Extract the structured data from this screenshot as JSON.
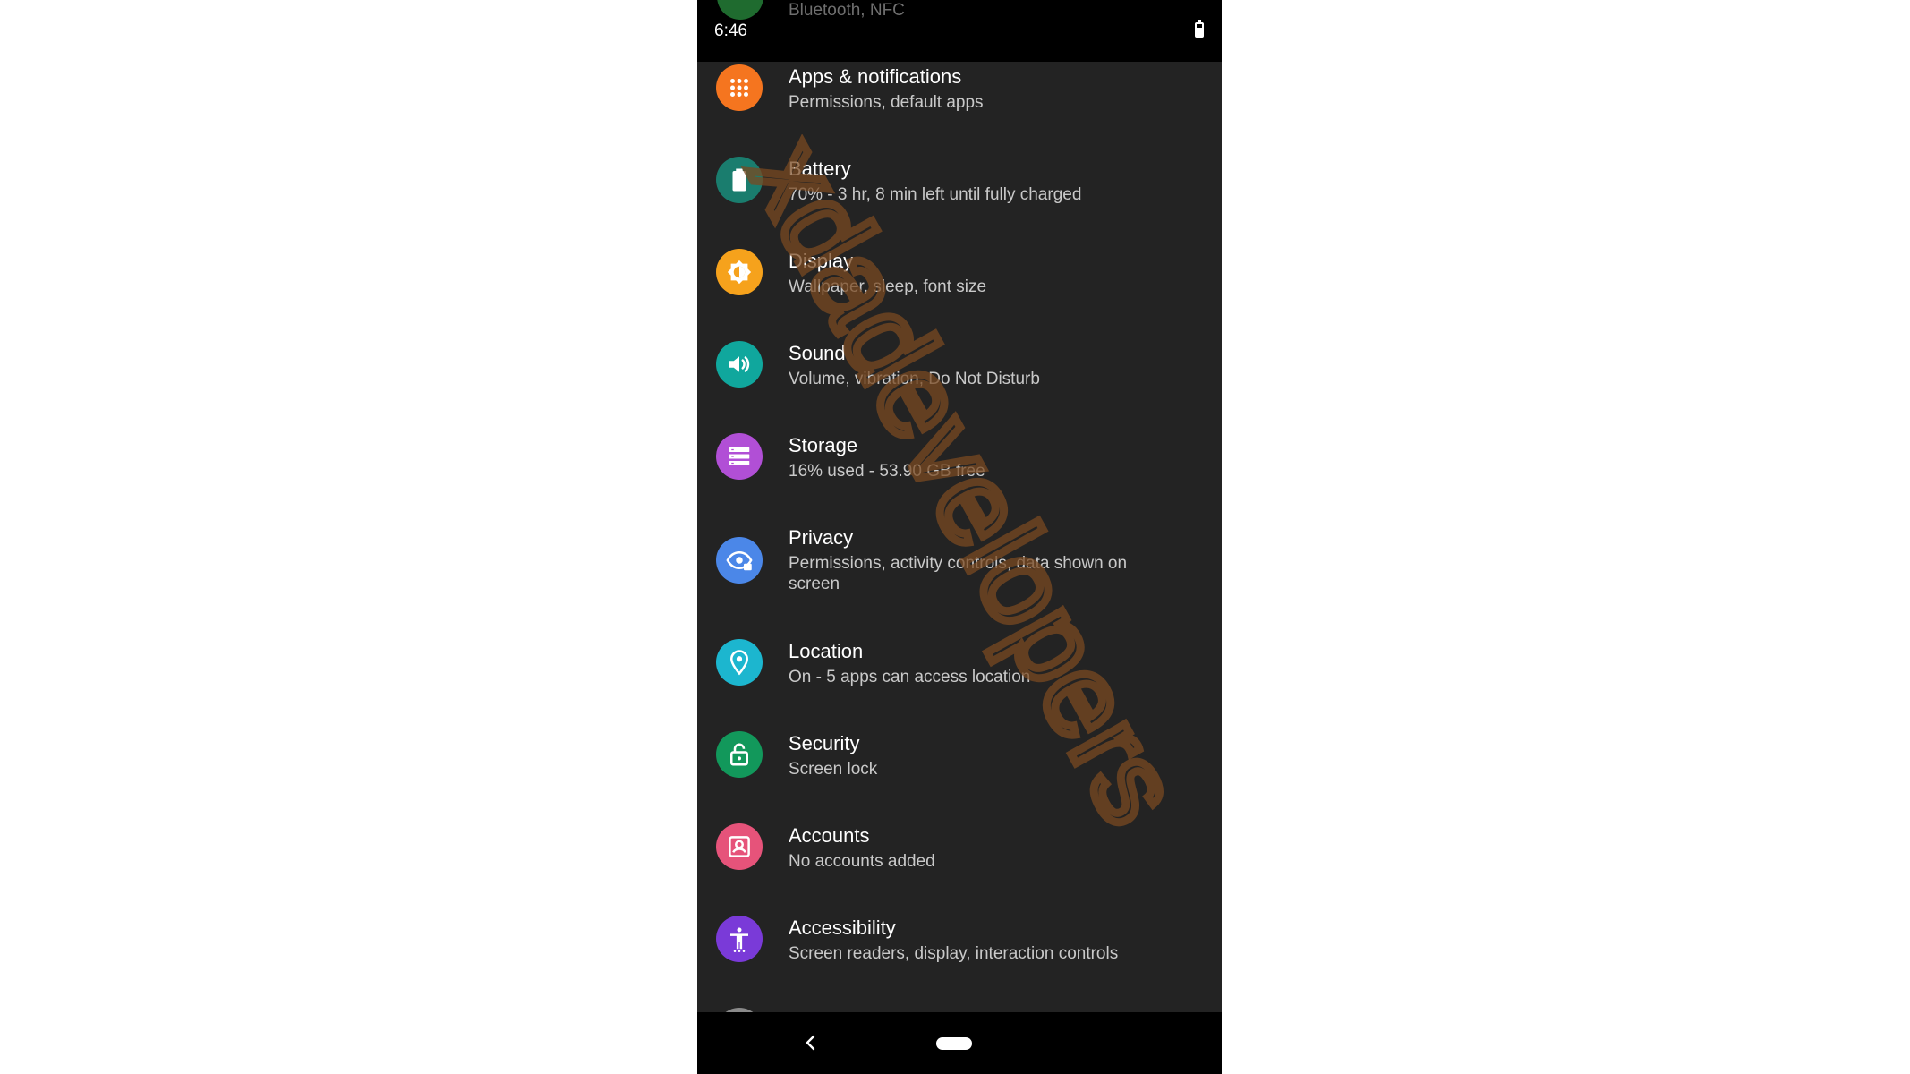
{
  "status_bar": {
    "time": "6:46"
  },
  "peek_item": {
    "subtitle": "Bluetooth, NFC"
  },
  "settings": [
    {
      "title": "Apps & notifications",
      "subtitle": "Permissions, default apps",
      "icon": "apps-grid-icon",
      "color": "#f5751f"
    },
    {
      "title": "Battery",
      "subtitle": "70% - 3 hr, 8 min left until fully charged",
      "icon": "battery-icon",
      "color": "#1a7d6e"
    },
    {
      "title": "Display",
      "subtitle": "Wallpaper, sleep, font size",
      "icon": "brightness-icon",
      "color": "#f6a21c"
    },
    {
      "title": "Sound",
      "subtitle": "Volume, vibration, Do Not Disturb",
      "icon": "volume-icon",
      "color": "#10a79d"
    },
    {
      "title": "Storage",
      "subtitle": "16% used - 53.90 GB free",
      "icon": "storage-icon",
      "color": "#b14fd6"
    },
    {
      "title": "Privacy",
      "subtitle": "Permissions, activity controls, data shown on screen",
      "icon": "privacy-eye-icon",
      "color": "#4b87e8"
    },
    {
      "title": "Location",
      "subtitle": "On - 5 apps can access location",
      "icon": "location-pin-icon",
      "color": "#1cb6cf"
    },
    {
      "title": "Security",
      "subtitle": "Screen lock",
      "icon": "lock-icon",
      "color": "#12985b"
    },
    {
      "title": "Accounts",
      "subtitle": "No accounts added",
      "icon": "account-icon",
      "color": "#e6537a"
    },
    {
      "title": "Accessibility",
      "subtitle": "Screen readers, display, interaction controls",
      "icon": "accessibility-icon",
      "color": "#7a3ad8"
    }
  ],
  "watermark": {
    "text": "xdadevelopers",
    "color": "#7a4a22"
  }
}
